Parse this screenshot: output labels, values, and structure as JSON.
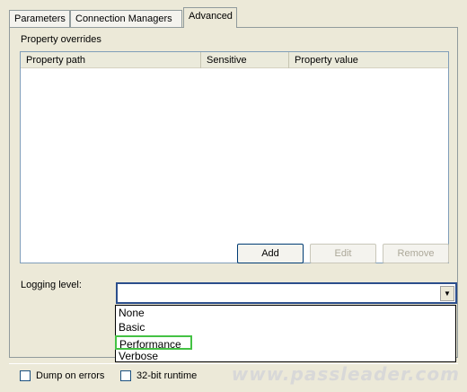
{
  "tabs": [
    {
      "label": "Parameters"
    },
    {
      "label": "Connection Managers"
    },
    {
      "label": "Advanced"
    }
  ],
  "active_tab": "Advanced",
  "property_overrides": {
    "label": "Property overrides",
    "columns": [
      "Property path",
      "Sensitive",
      "Property value"
    ]
  },
  "buttons": {
    "add": "Add",
    "edit": "Edit",
    "remove": "Remove"
  },
  "logging": {
    "label": "Logging level:",
    "selected": "",
    "options": [
      "None",
      "Basic",
      "Performance",
      "Verbose"
    ],
    "highlighted_option": "Performance"
  },
  "options": {
    "dump_on_errors": "Dump on errors",
    "runtime_32bit": "32-bit runtime"
  },
  "watermark": "www.passleader.com",
  "colors": {
    "highlight_border": "#44c244",
    "dialog_bg": "#ece9d8"
  }
}
